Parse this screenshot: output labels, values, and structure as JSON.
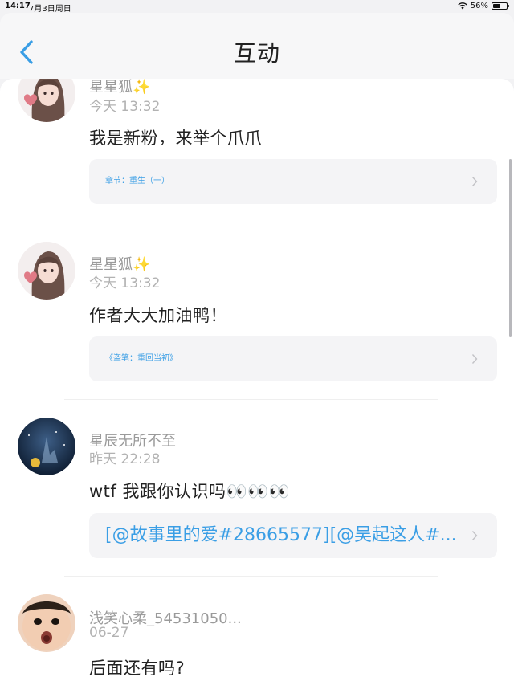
{
  "status_bar": {
    "time": "14:17",
    "date": "7月3日周日",
    "battery": "56%",
    "battery_level": 0.56
  },
  "header": {
    "title": "互动",
    "back_icon": "chevron-left-icon",
    "accent_color": "#3a9ee5"
  },
  "comments": [
    {
      "user": "星星狐✨",
      "time": "今天 13:32",
      "text": "我是新粉，来举个爪爪",
      "reference": "章节：重生（一）"
    },
    {
      "user": "星星狐✨",
      "time": "今天 13:32",
      "text": "作者大大加油鸭！",
      "reference": "《盗笔：重回当初》"
    },
    {
      "user": "星辰无所不至",
      "time": "昨天 22:28",
      "text": "wtf 我跟你认识吗👀👀👀",
      "reference": "[@故事里的爱#28665577][@吴起这人#..."
    },
    {
      "user": "浅笑心柔_54531050...",
      "time": "06-27",
      "text": "后面还有吗?"
    }
  ]
}
